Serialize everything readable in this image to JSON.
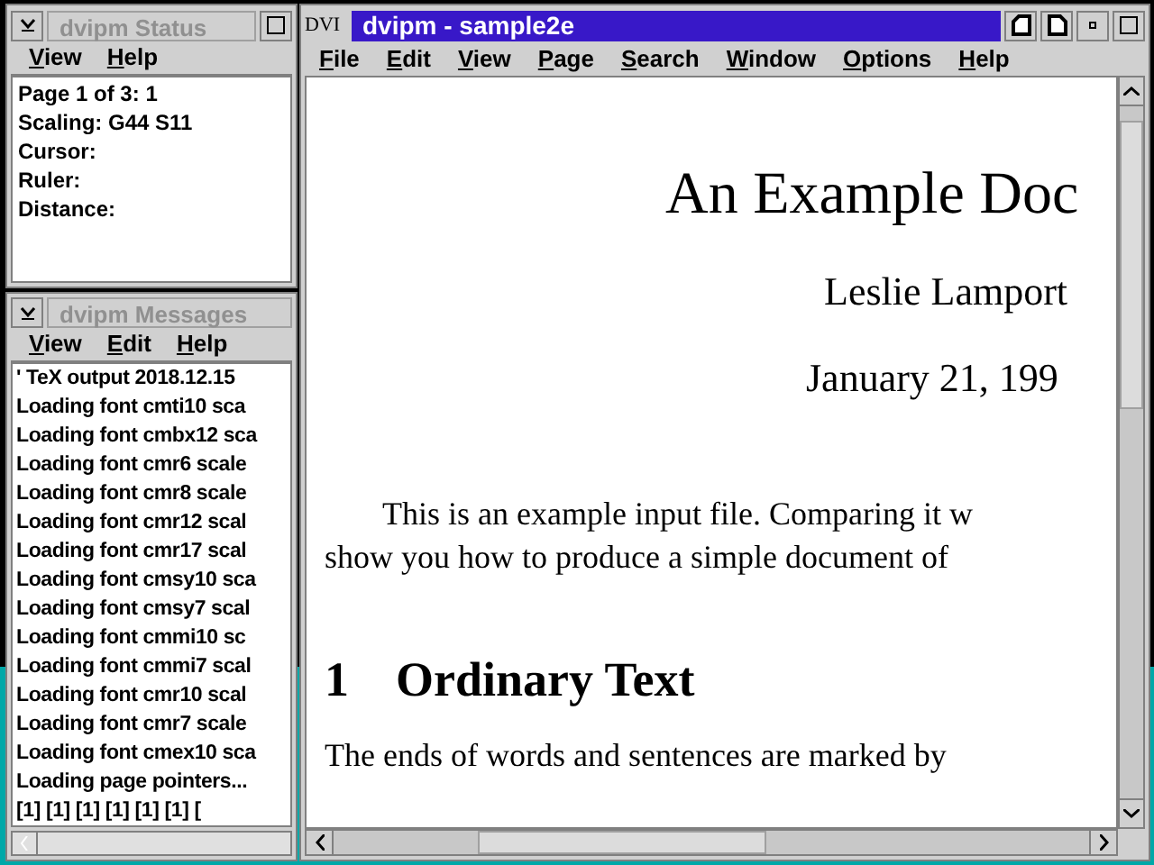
{
  "status_window": {
    "title": "dvipm Status",
    "menu": [
      "View",
      "Help"
    ],
    "lines": [
      "Page 1 of 3: 1",
      "Scaling: G44 S11",
      "Cursor:",
      "Ruler:",
      "Distance:"
    ]
  },
  "messages_window": {
    "title": "dvipm Messages",
    "menu": [
      "View",
      "Edit",
      "Help"
    ],
    "lines": [
      "' TeX output 2018.12.15",
      "Loading font cmti10 sca",
      "Loading font cmbx12 sca",
      "Loading font cmr6 scale",
      "Loading font cmr8 scale",
      "Loading font cmr12 scal",
      "Loading font cmr17 scal",
      "Loading font cmsy10 sca",
      "Loading font cmsy7 scal",
      "Loading font cmmi10 sc",
      "Loading font cmmi7 scal",
      "Loading font cmr10 scal",
      "Loading font cmr7 scale",
      "Loading font cmex10 sca",
      "Loading page pointers...",
      "[1] [1] [1] [1] [1] [1] ["
    ]
  },
  "main_window": {
    "icon_label": "DVI",
    "title": "dvipm - sample2e",
    "menu": [
      "File",
      "Edit",
      "View",
      "Page",
      "Search",
      "Window",
      "Options",
      "Help"
    ],
    "document": {
      "title": "An Example Doc",
      "author": "Leslie Lamport",
      "date": "January 21, 199",
      "paragraph_lines": [
        "This is an example input file. Comparing it w",
        "show you how to produce a simple document of"
      ],
      "section_number": "1",
      "section_title": "Ordinary Text",
      "body_lines": [
        "The ends of words and sentences are marked by"
      ]
    }
  }
}
